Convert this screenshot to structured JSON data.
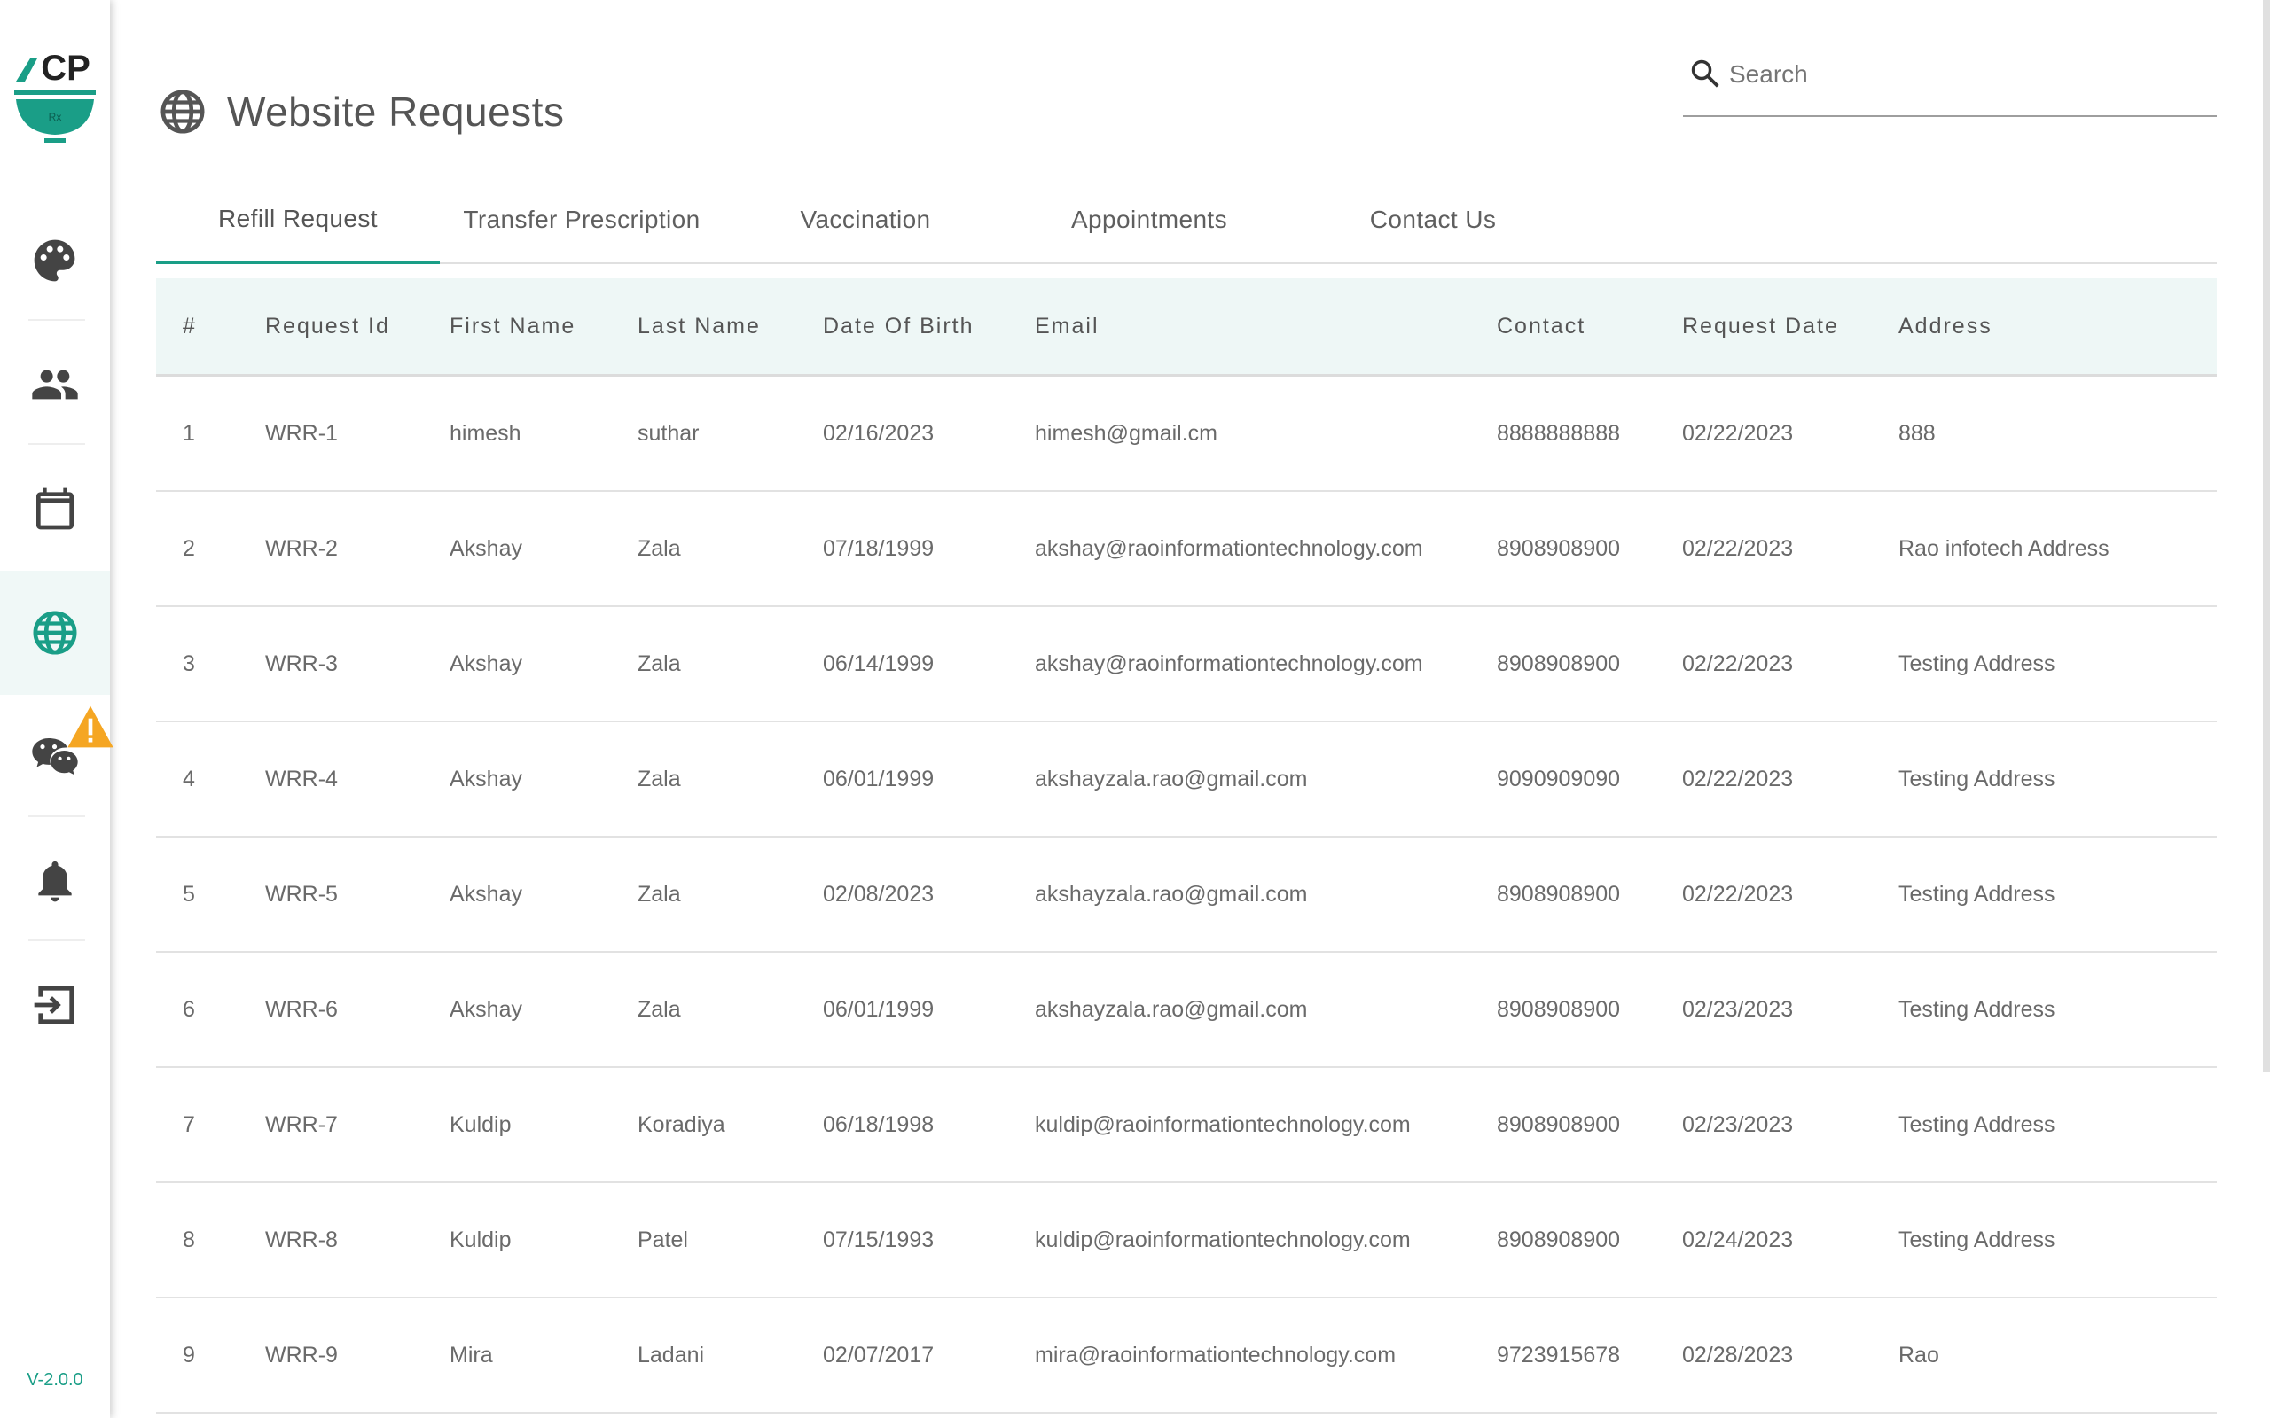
{
  "sidebar": {
    "logo_text": "CP",
    "logo_sub": "Rx",
    "items": [
      {
        "name": "dashboard",
        "icon": "palette-icon"
      },
      {
        "name": "users",
        "icon": "people-icon"
      },
      {
        "name": "calendar",
        "icon": "calendar-icon"
      },
      {
        "name": "website-requests",
        "icon": "globe-icon",
        "active": true
      },
      {
        "name": "chat",
        "icon": "chat-icon",
        "badge": "warning-icon"
      },
      {
        "name": "notifications",
        "icon": "bell-icon"
      },
      {
        "name": "logout",
        "icon": "logout-icon"
      }
    ],
    "version": "V-2.0.0",
    "accent": "#1a9e87"
  },
  "header": {
    "title": "Website Requests",
    "icon": "globe-icon"
  },
  "search": {
    "placeholder": "Search",
    "value": ""
  },
  "tabs": [
    {
      "label": "Refill Request",
      "active": true
    },
    {
      "label": "Transfer Prescription"
    },
    {
      "label": "Vaccination"
    },
    {
      "label": "Appointments"
    },
    {
      "label": "Contact Us"
    }
  ],
  "table": {
    "headers": [
      "#",
      "Request Id",
      "First Name",
      "Last Name",
      "Date Of Birth",
      "Email",
      "Contact",
      "Request Date",
      "Address"
    ],
    "rows": [
      [
        "1",
        "WRR-1",
        "himesh",
        "suthar",
        "02/16/2023",
        "himesh@gmail.cm",
        "8888888888",
        "02/22/2023",
        "888"
      ],
      [
        "2",
        "WRR-2",
        "Akshay",
        "Zala",
        "07/18/1999",
        "akshay@raoinformationtechnology.com",
        "8908908900",
        "02/22/2023",
        "Rao infotech Address"
      ],
      [
        "3",
        "WRR-3",
        "Akshay",
        "Zala",
        "06/14/1999",
        "akshay@raoinformationtechnology.com",
        "8908908900",
        "02/22/2023",
        "Testing Address"
      ],
      [
        "4",
        "WRR-4",
        "Akshay",
        "Zala",
        "06/01/1999",
        "akshayzala.rao@gmail.com",
        "9090909090",
        "02/22/2023",
        "Testing Address"
      ],
      [
        "5",
        "WRR-5",
        "Akshay",
        "Zala",
        "02/08/2023",
        "akshayzala.rao@gmail.com",
        "8908908900",
        "02/22/2023",
        "Testing Address"
      ],
      [
        "6",
        "WRR-6",
        "Akshay",
        "Zala",
        "06/01/1999",
        "akshayzala.rao@gmail.com",
        "8908908900",
        "02/23/2023",
        "Testing Address"
      ],
      [
        "7",
        "WRR-7",
        "Kuldip",
        "Koradiya",
        "06/18/1998",
        "kuldip@raoinformationtechnology.com",
        "8908908900",
        "02/23/2023",
        "Testing Address"
      ],
      [
        "8",
        "WRR-8",
        "Kuldip",
        "Patel",
        "07/15/1993",
        "kuldip@raoinformationtechnology.com",
        "8908908900",
        "02/24/2023",
        "Testing Address"
      ],
      [
        "9",
        "WRR-9",
        "Mira",
        "Ladani",
        "02/07/2017",
        "mira@raoinformationtechnology.com",
        "9723915678",
        "02/28/2023",
        "Rao"
      ]
    ]
  }
}
